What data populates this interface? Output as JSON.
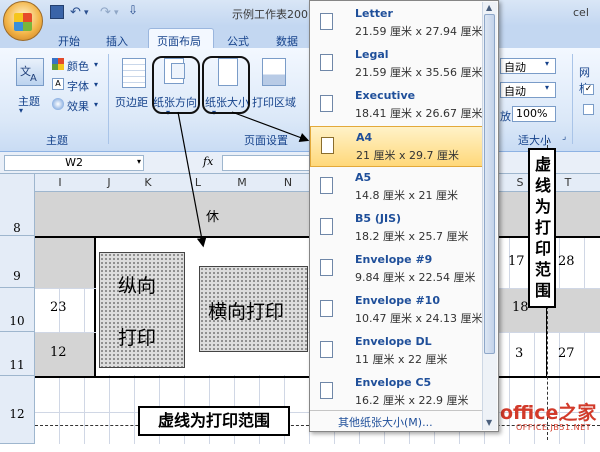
{
  "titlebar": {
    "title": "示例工作表200",
    "title_suffix": "cel"
  },
  "tabs": [
    {
      "label": "开始"
    },
    {
      "label": "插入"
    },
    {
      "label": "页面布局"
    },
    {
      "label": "公式"
    },
    {
      "label": "数据"
    }
  ],
  "ribbon": {
    "theme_group": {
      "theme_label": "主题",
      "colors_label": "颜色",
      "fonts_label": "字体",
      "effects_label": "效果",
      "group_label": "主题"
    },
    "page_setup": {
      "margins_label": "页边距",
      "orientation_label": "纸张方向",
      "size_label": "纸张大小",
      "print_area_label": "打印区域",
      "group_label": "页面设置"
    },
    "scale_fit": {
      "width_value": "自动",
      "height_value": "自动",
      "scale_value": "100%",
      "scale_prefix": "放:",
      "group_label": "适大小"
    },
    "sheet_options": {
      "gridlines_label": "网格"
    }
  },
  "formula_bar": {
    "name_box": "W2",
    "fx": "fx"
  },
  "columns": [
    "I",
    "J",
    "K",
    "L",
    "M",
    "N",
    "S",
    "T"
  ],
  "rows": [
    "8",
    "9",
    "10",
    "11",
    "12"
  ],
  "sheet": {
    "row8_text": "休",
    "cells": {
      "r9_s": "17",
      "r9_t": "28",
      "r10_i": "23",
      "r10_s": "18",
      "r11_i": "12",
      "r11_s": "3",
      "r11_t": "27"
    },
    "box_portrait": [
      "纵向",
      "打印"
    ],
    "box_landscape": "横向打印",
    "vertical_note": [
      "虚",
      "线",
      "为",
      "打",
      "印",
      "范",
      "围"
    ],
    "bottom_note": "虚线为打印范围"
  },
  "paper_menu": {
    "items": [
      {
        "name": "Letter",
        "size": "21.59 厘米 x 27.94 厘米"
      },
      {
        "name": "Legal",
        "size": "21.59 厘米 x 35.56 厘米"
      },
      {
        "name": "Executive",
        "size": "18.41 厘米 x 26.67 厘米"
      },
      {
        "name": "A4",
        "size": "21 厘米 x 29.7 厘米"
      },
      {
        "name": "A5",
        "size": "14.8 厘米 x 21 厘米"
      },
      {
        "name": "B5 (JIS)",
        "size": "18.2 厘米 x 25.7 厘米"
      },
      {
        "name": "Envelope #9",
        "size": "9.84 厘米 x 22.54 厘米"
      },
      {
        "name": "Envelope #10",
        "size": "10.47 厘米 x 24.13 厘米"
      },
      {
        "name": "Envelope DL",
        "size": "11 厘米 x 22 厘米"
      },
      {
        "name": "Envelope C5",
        "size": "16.2 厘米 x 22.9 厘米"
      }
    ],
    "selected": "A4",
    "more_label": "其他纸张大小(M)..."
  },
  "watermark": {
    "brand": "office之家",
    "url": "OFFICE.JB51.NET"
  }
}
